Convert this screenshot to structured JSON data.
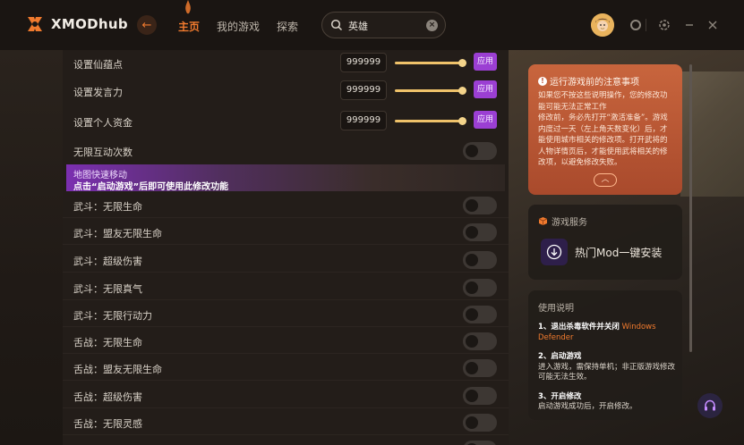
{
  "app": {
    "logo_text": "XMODhub",
    "nav": [
      {
        "label": "主页",
        "active": true
      },
      {
        "label": "我的游戏",
        "active": false
      },
      {
        "label": "探索",
        "active": false
      }
    ],
    "search": {
      "value": "英雄"
    }
  },
  "options": [
    {
      "label": "设置仙蕴点",
      "type": "number",
      "value": "999999",
      "slider_fraction": 0.97,
      "apply": "应用"
    },
    {
      "label": "设置发言力",
      "type": "number",
      "value": "999999",
      "slider_fraction": 0.97,
      "apply": "应用"
    },
    {
      "label": "设置个人资金",
      "type": "number",
      "value": "999999",
      "slider_fraction": 0.97,
      "apply": "应用"
    },
    {
      "label": "无限互动次数",
      "type": "toggle",
      "on": false
    }
  ],
  "section": {
    "title": "地图快速移动",
    "subtitle": "点击“启动游戏”后即可使用此修改功能"
  },
  "toggles": [
    {
      "label": "武斗：无限生命",
      "on": false
    },
    {
      "label": "武斗：盟友无限生命",
      "on": false
    },
    {
      "label": "武斗：超级伤害",
      "on": false
    },
    {
      "label": "武斗：无限真气",
      "on": false
    },
    {
      "label": "武斗：无限行动力",
      "on": false
    },
    {
      "label": "舌战：无限生命",
      "on": false
    },
    {
      "label": "舌战：盟友无限生命",
      "on": false
    },
    {
      "label": "舌战：超级伤害",
      "on": false
    },
    {
      "label": "舌战：无限灵感",
      "on": false
    }
  ],
  "notice": {
    "title": "运行游戏前的注意事项",
    "body": "如果您不按这些说明操作，您的修改功能可能无法正常工作\n修改前，务必先打开“激活准备”。游戏内度过一天（左上角天数变化）后，才能使用城市相关的修改项。打开武将的人物详情页后，才能使用武将相关的修改项，以避免修改失败。",
    "collapse_glyph": "︿"
  },
  "services": {
    "title": "游戏服务",
    "item_label": "热门Mod一键安装"
  },
  "guide": {
    "title": "使用说明",
    "steps": [
      {
        "head": "1、退出杀毒软件并关闭",
        "highlight": " Windows Defender",
        "detail": ""
      },
      {
        "head": "2、启动游戏",
        "highlight": "",
        "detail": "进入游戏，需保持单机；非正版游戏修改可能无法生效。"
      },
      {
        "head": "3、开启修改",
        "highlight": "",
        "detail": "启动游戏成功后，开启修改。"
      }
    ]
  },
  "colors": {
    "accent": "#f07a2e",
    "apply_purple": "#9b3fd3",
    "notice_bg": "#c8653d",
    "slider": "#efc26a"
  }
}
